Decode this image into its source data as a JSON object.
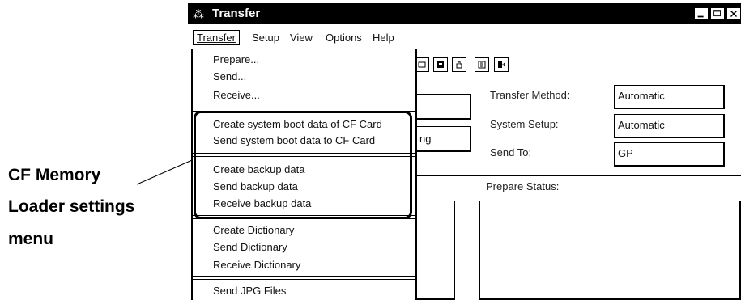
{
  "callout": {
    "line1": "CF Memory",
    "line2": "Loader settings",
    "line3": "menu"
  },
  "window": {
    "title": "Transfer",
    "app_icon": "transfer-app-icon",
    "controls": [
      "minimize-icon",
      "maximize-icon",
      "close-icon"
    ]
  },
  "menubar": {
    "items": [
      "Transfer",
      "Setup",
      "View",
      "Options",
      "Help"
    ],
    "open": "Transfer"
  },
  "toolbar": {
    "icons": [
      "toolbar-button-icon-1",
      "toolbar-button-icon-2",
      "toolbar-hand-icon",
      "toolbar-button-icon-4",
      "toolbar-exit-icon"
    ]
  },
  "settings": {
    "transfer_method_label": "Transfer Method:",
    "transfer_method_value": "Automatic",
    "system_setup_label": "System Setup:",
    "system_setup_value": "Automatic",
    "send_to_label": "Send To:",
    "send_to_value": "GP",
    "partial_field_text": "ng",
    "prepare_status_label": "Prepare Status:"
  },
  "transfer_menu": {
    "group1": [
      "Prepare...",
      "Send...",
      "Receive..."
    ],
    "group2": [
      "Create system boot data of CF Card",
      "Send system boot data to CF Card"
    ],
    "group3": [
      "Create backup data",
      "Send backup data",
      "Receive backup data"
    ],
    "group4": [
      "Create Dictionary",
      "Send Dictionary",
      "Receive Dictionary"
    ],
    "group5": [
      "Send JPG Files"
    ]
  }
}
